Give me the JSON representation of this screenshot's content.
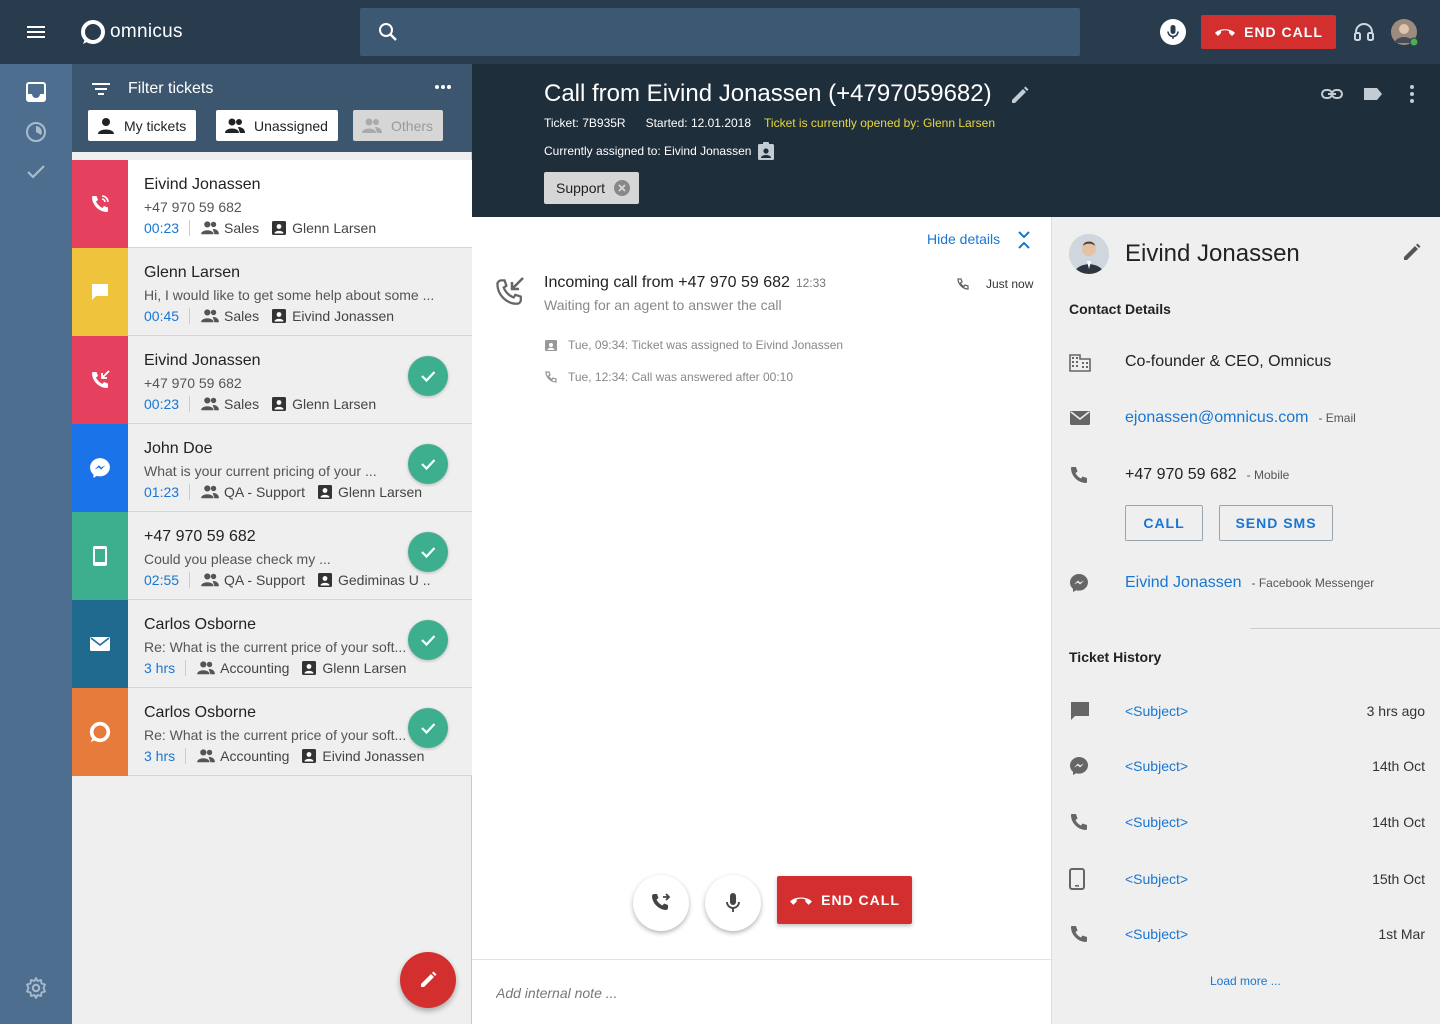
{
  "topbar": {
    "logo_text": "omnicus",
    "search_placeholder": "",
    "end_call_label": "END CALL",
    "colors": {
      "bar": "#283c4e",
      "search": "#3d5872",
      "end_call": "#d32f2f"
    }
  },
  "list": {
    "filter_title": "Filter tickets",
    "filters": [
      {
        "label": "My tickets",
        "icon": "person-icon",
        "enabled": true
      },
      {
        "label": "Unassigned",
        "icon": "group-icon",
        "enabled": true
      },
      {
        "label": "Others",
        "icon": "group-icon",
        "enabled": false
      }
    ],
    "tickets": [
      {
        "name": "Eivind Jonassen",
        "sub": "+47  970 59 682",
        "time": "00:23",
        "group": "Sales",
        "agent": "Glenn Larsen",
        "color": "#e5405e",
        "icon": "phone-in-talk-icon",
        "done": false,
        "active": true
      },
      {
        "name": "Glenn Larsen",
        "sub": "Hi, I would like to get some help about some ...",
        "time": "00:45",
        "group": "Sales",
        "agent": "Eivind Jonassen",
        "color": "#f0c33c",
        "icon": "chat-icon",
        "done": false,
        "active": false
      },
      {
        "name": "Eivind Jonassen",
        "sub": "+47  970 59 682",
        "time": "00:23",
        "group": "Sales",
        "agent": "Glenn Larsen",
        "color": "#e5405e",
        "icon": "phone-incoming-icon",
        "done": true,
        "active": false
      },
      {
        "name": "John Doe",
        "sub": "What is your current pricing of your  ...",
        "time": "01:23",
        "group": "QA - Support",
        "agent": "Glenn Larsen",
        "color": "#1a73e8",
        "icon": "messenger-icon",
        "done": true,
        "active": false
      },
      {
        "name": "+47 970 59 682",
        "sub": "Could you please check my ...",
        "time": "02:55",
        "group": "QA - Support",
        "agent": "Gediminas U ..",
        "color": "#3dae8e",
        "icon": "mobile-icon",
        "done": true,
        "active": false
      },
      {
        "name": "Carlos Osborne",
        "sub": "Re: What is the current price of your soft...",
        "time": "3 hrs",
        "group": "Accounting",
        "agent": "Glenn Larsen",
        "color": "#1f6a8e",
        "icon": "email-icon",
        "done": true,
        "active": false
      },
      {
        "name": "Carlos Osborne",
        "sub": "Re: What is the current price of your soft...",
        "time": "3 hrs",
        "group": "Accounting",
        "agent": "Eivind Jonassen",
        "color": "#e77b3c",
        "icon": "omnicus-icon",
        "done": true,
        "active": false
      }
    ]
  },
  "detail": {
    "title": "Call from Eivind Jonassen (+4797059682)",
    "ticket": "Ticket: 7B935R",
    "started": "Started: 12.01.2018",
    "opened_by": "Ticket is currently opened by: Glenn Larsen",
    "assigned": "Currently assigned to:  Eivind Jonassen",
    "tag": "Support"
  },
  "timeline": {
    "hide_details": "Hide details",
    "event_title": "Incoming call from +47 970 59 682",
    "event_time": "12:33",
    "event_sub": "Waiting for an agent to answer the call",
    "event_when": "Just now",
    "logs": [
      "Tue, 09:34: Ticket was assigned to Eivind Jonassen",
      "Tue, 12:34: Call was answered after 00:10"
    ],
    "end_call_label": "END CALL",
    "note_placeholder": "Add internal note ..."
  },
  "contact": {
    "name": "Eivind Jonassen",
    "details_title": "Contact Details",
    "company": "Co-founder & CEO, Omnicus",
    "email": "ejonassen@omnicus.com",
    "email_label": "- Email",
    "phone": "+47 970 59 682",
    "phone_label": "- Mobile",
    "call_label": "CALL",
    "sms_label": "SEND SMS",
    "messenger": "Eivind Jonassen",
    "messenger_label": "- Facebook Messenger",
    "history_title": "Ticket History",
    "history": [
      {
        "subject": "<Subject>",
        "when": "3 hrs ago",
        "icon": "chat-icon"
      },
      {
        "subject": "<Subject>",
        "when": "14th Oct",
        "icon": "messenger-icon"
      },
      {
        "subject": "<Subject>",
        "when": "14th Oct",
        "icon": "phone-icon"
      },
      {
        "subject": "<Subject>",
        "when": "15th Oct",
        "icon": "mobile-icon"
      },
      {
        "subject": "<Subject>",
        "when": "1st Mar",
        "icon": "phone-icon"
      }
    ],
    "load_more": "Load more ..."
  }
}
